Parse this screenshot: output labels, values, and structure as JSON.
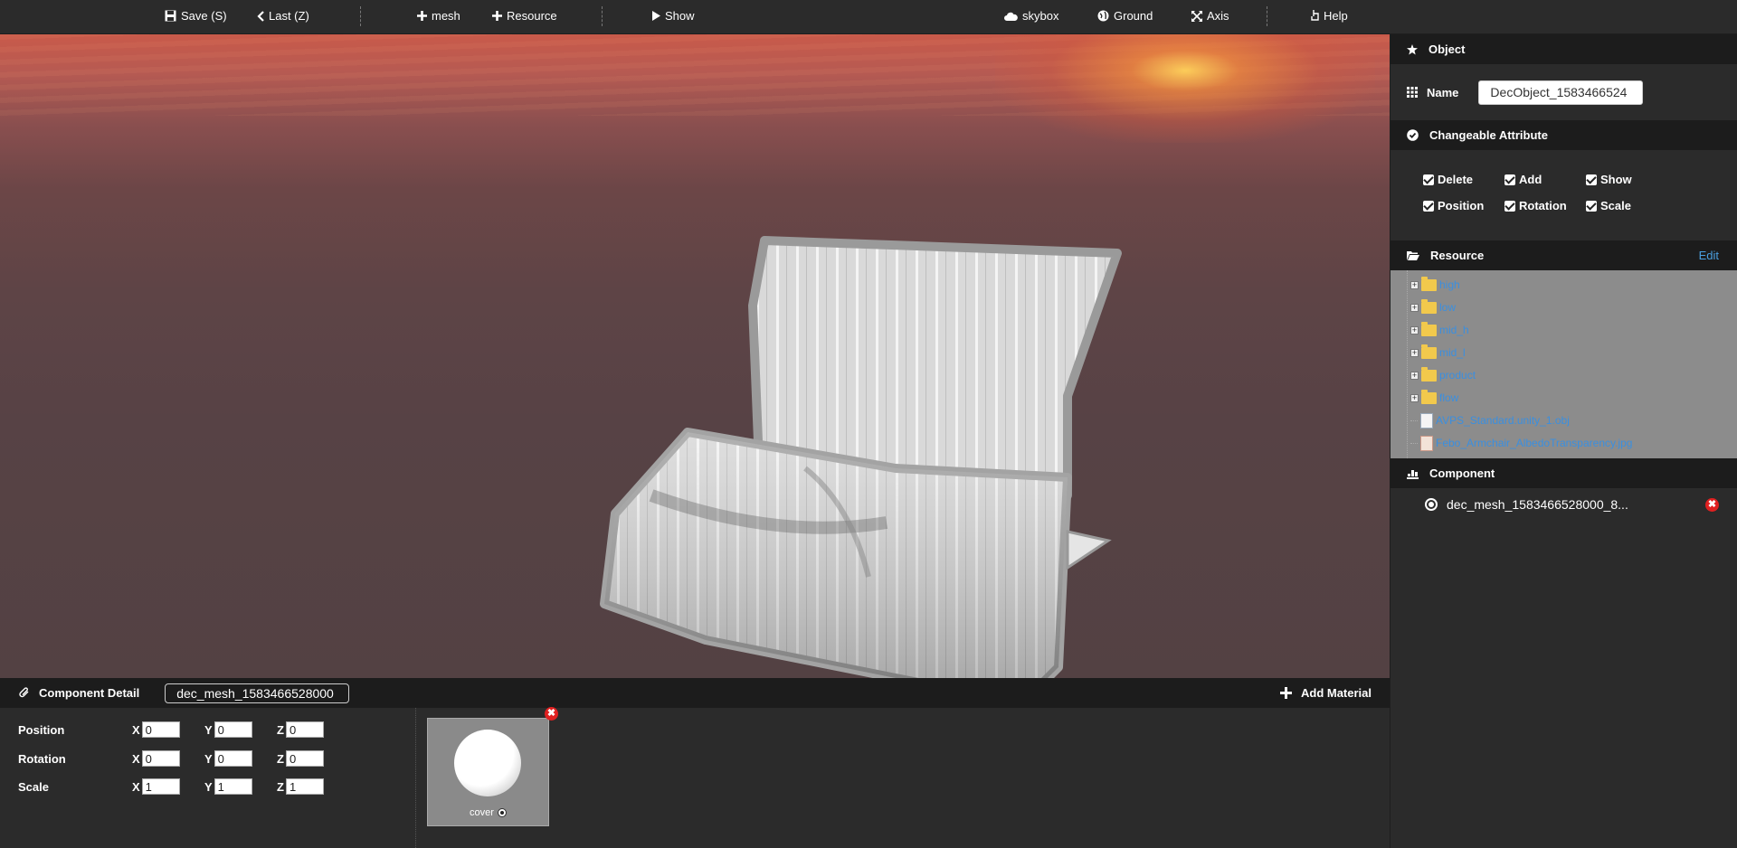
{
  "toolbar": {
    "save": "Save (S)",
    "last": "Last (Z)",
    "mesh": "mesh",
    "resource": "Resource",
    "show": "Show",
    "skybox": "skybox",
    "ground": "Ground",
    "axis": "Axis",
    "help": "Help"
  },
  "right_panel": {
    "object_title": "Object",
    "name_label": "Name",
    "name_value": "DecObject_1583466524",
    "changeable_title": "Changeable Attribute",
    "attributes": [
      "Delete",
      "Add",
      "Show",
      "Position",
      "Rotation",
      "Scale"
    ],
    "resource_title": "Resource",
    "resource_edit": "Edit",
    "resource_items": [
      "high",
      "low",
      "mid_h",
      "mid_l",
      "product",
      "flow",
      "AVPS_Standard.unity_1.obj",
      "Febo_Armchair_AlbedoTransparency.jpg"
    ],
    "component_title": "Component",
    "component_item": "dec_mesh_1583466528000_8..."
  },
  "bottom_panel": {
    "title": "Component Detail",
    "component_name": "dec_mesh_1583466528000",
    "add_material": "Add Material",
    "rows": [
      {
        "label": "Position",
        "x": "0",
        "y": "0",
        "z": "0"
      },
      {
        "label": "Rotation",
        "x": "0",
        "y": "0",
        "z": "0"
      },
      {
        "label": "Scale",
        "x": "1",
        "y": "1",
        "z": "1"
      }
    ],
    "axis_labels": [
      "X",
      "Y",
      "Z"
    ],
    "material_label": "cover"
  },
  "colors": {
    "panel_bg": "#2b2b2b",
    "header_bg": "#1c1c1c",
    "link_blue": "#3a8fe0",
    "delete_red": "#e02020"
  }
}
